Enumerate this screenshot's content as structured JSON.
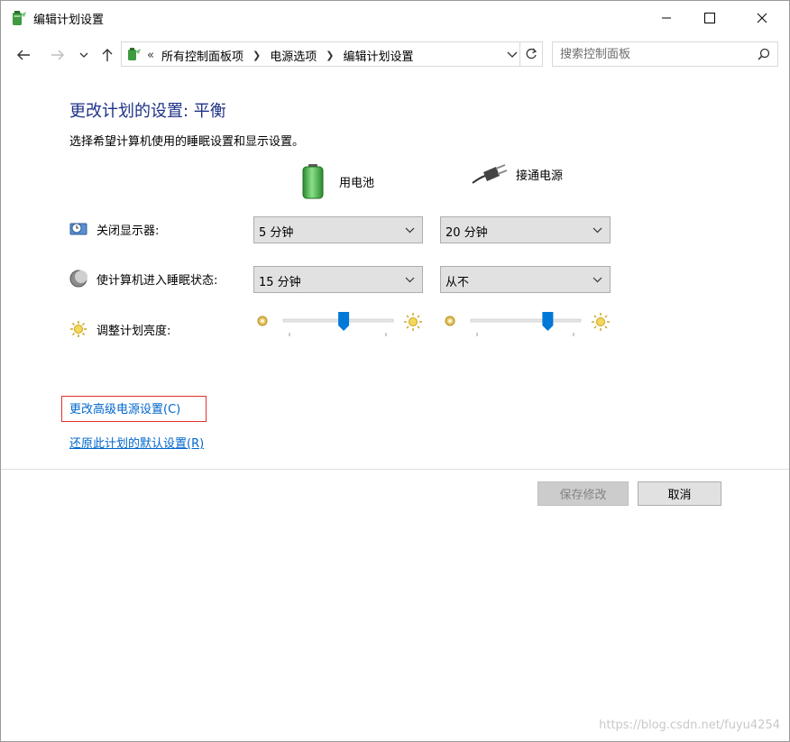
{
  "window": {
    "title": "编辑计划设置"
  },
  "address": {
    "overflow": "«",
    "crumbs": [
      "所有控制面板项",
      "电源选项",
      "编辑计划设置"
    ]
  },
  "search": {
    "placeholder": "搜索控制面板"
  },
  "main": {
    "heading": "更改计划的设置: 平衡",
    "subtext": "选择希望计算机使用的睡眠设置和显示设置。",
    "columns": {
      "battery": "用电池",
      "plugged": "接通电源"
    },
    "rows": {
      "display": {
        "label": "关闭显示器:",
        "battery": "5 分钟",
        "plugged": "20 分钟"
      },
      "sleep": {
        "label": "使计算机进入睡眠状态:",
        "battery": "15 分钟",
        "plugged": "从不"
      },
      "brightness": {
        "label": "调整计划亮度:",
        "battery_level": 0.55,
        "plugged_level": 0.7
      }
    },
    "links": {
      "advanced": "更改高级电源设置(C)",
      "restore": "还原此计划的默认设置(R)"
    }
  },
  "buttons": {
    "save": "保存修改",
    "cancel": "取消"
  },
  "watermark": "https://blog.csdn.net/fuyu4254",
  "colors": {
    "heading": "#1e3287",
    "link": "#0066cc",
    "slider_thumb": "#0078d7",
    "highlight_box": "#e03030"
  }
}
